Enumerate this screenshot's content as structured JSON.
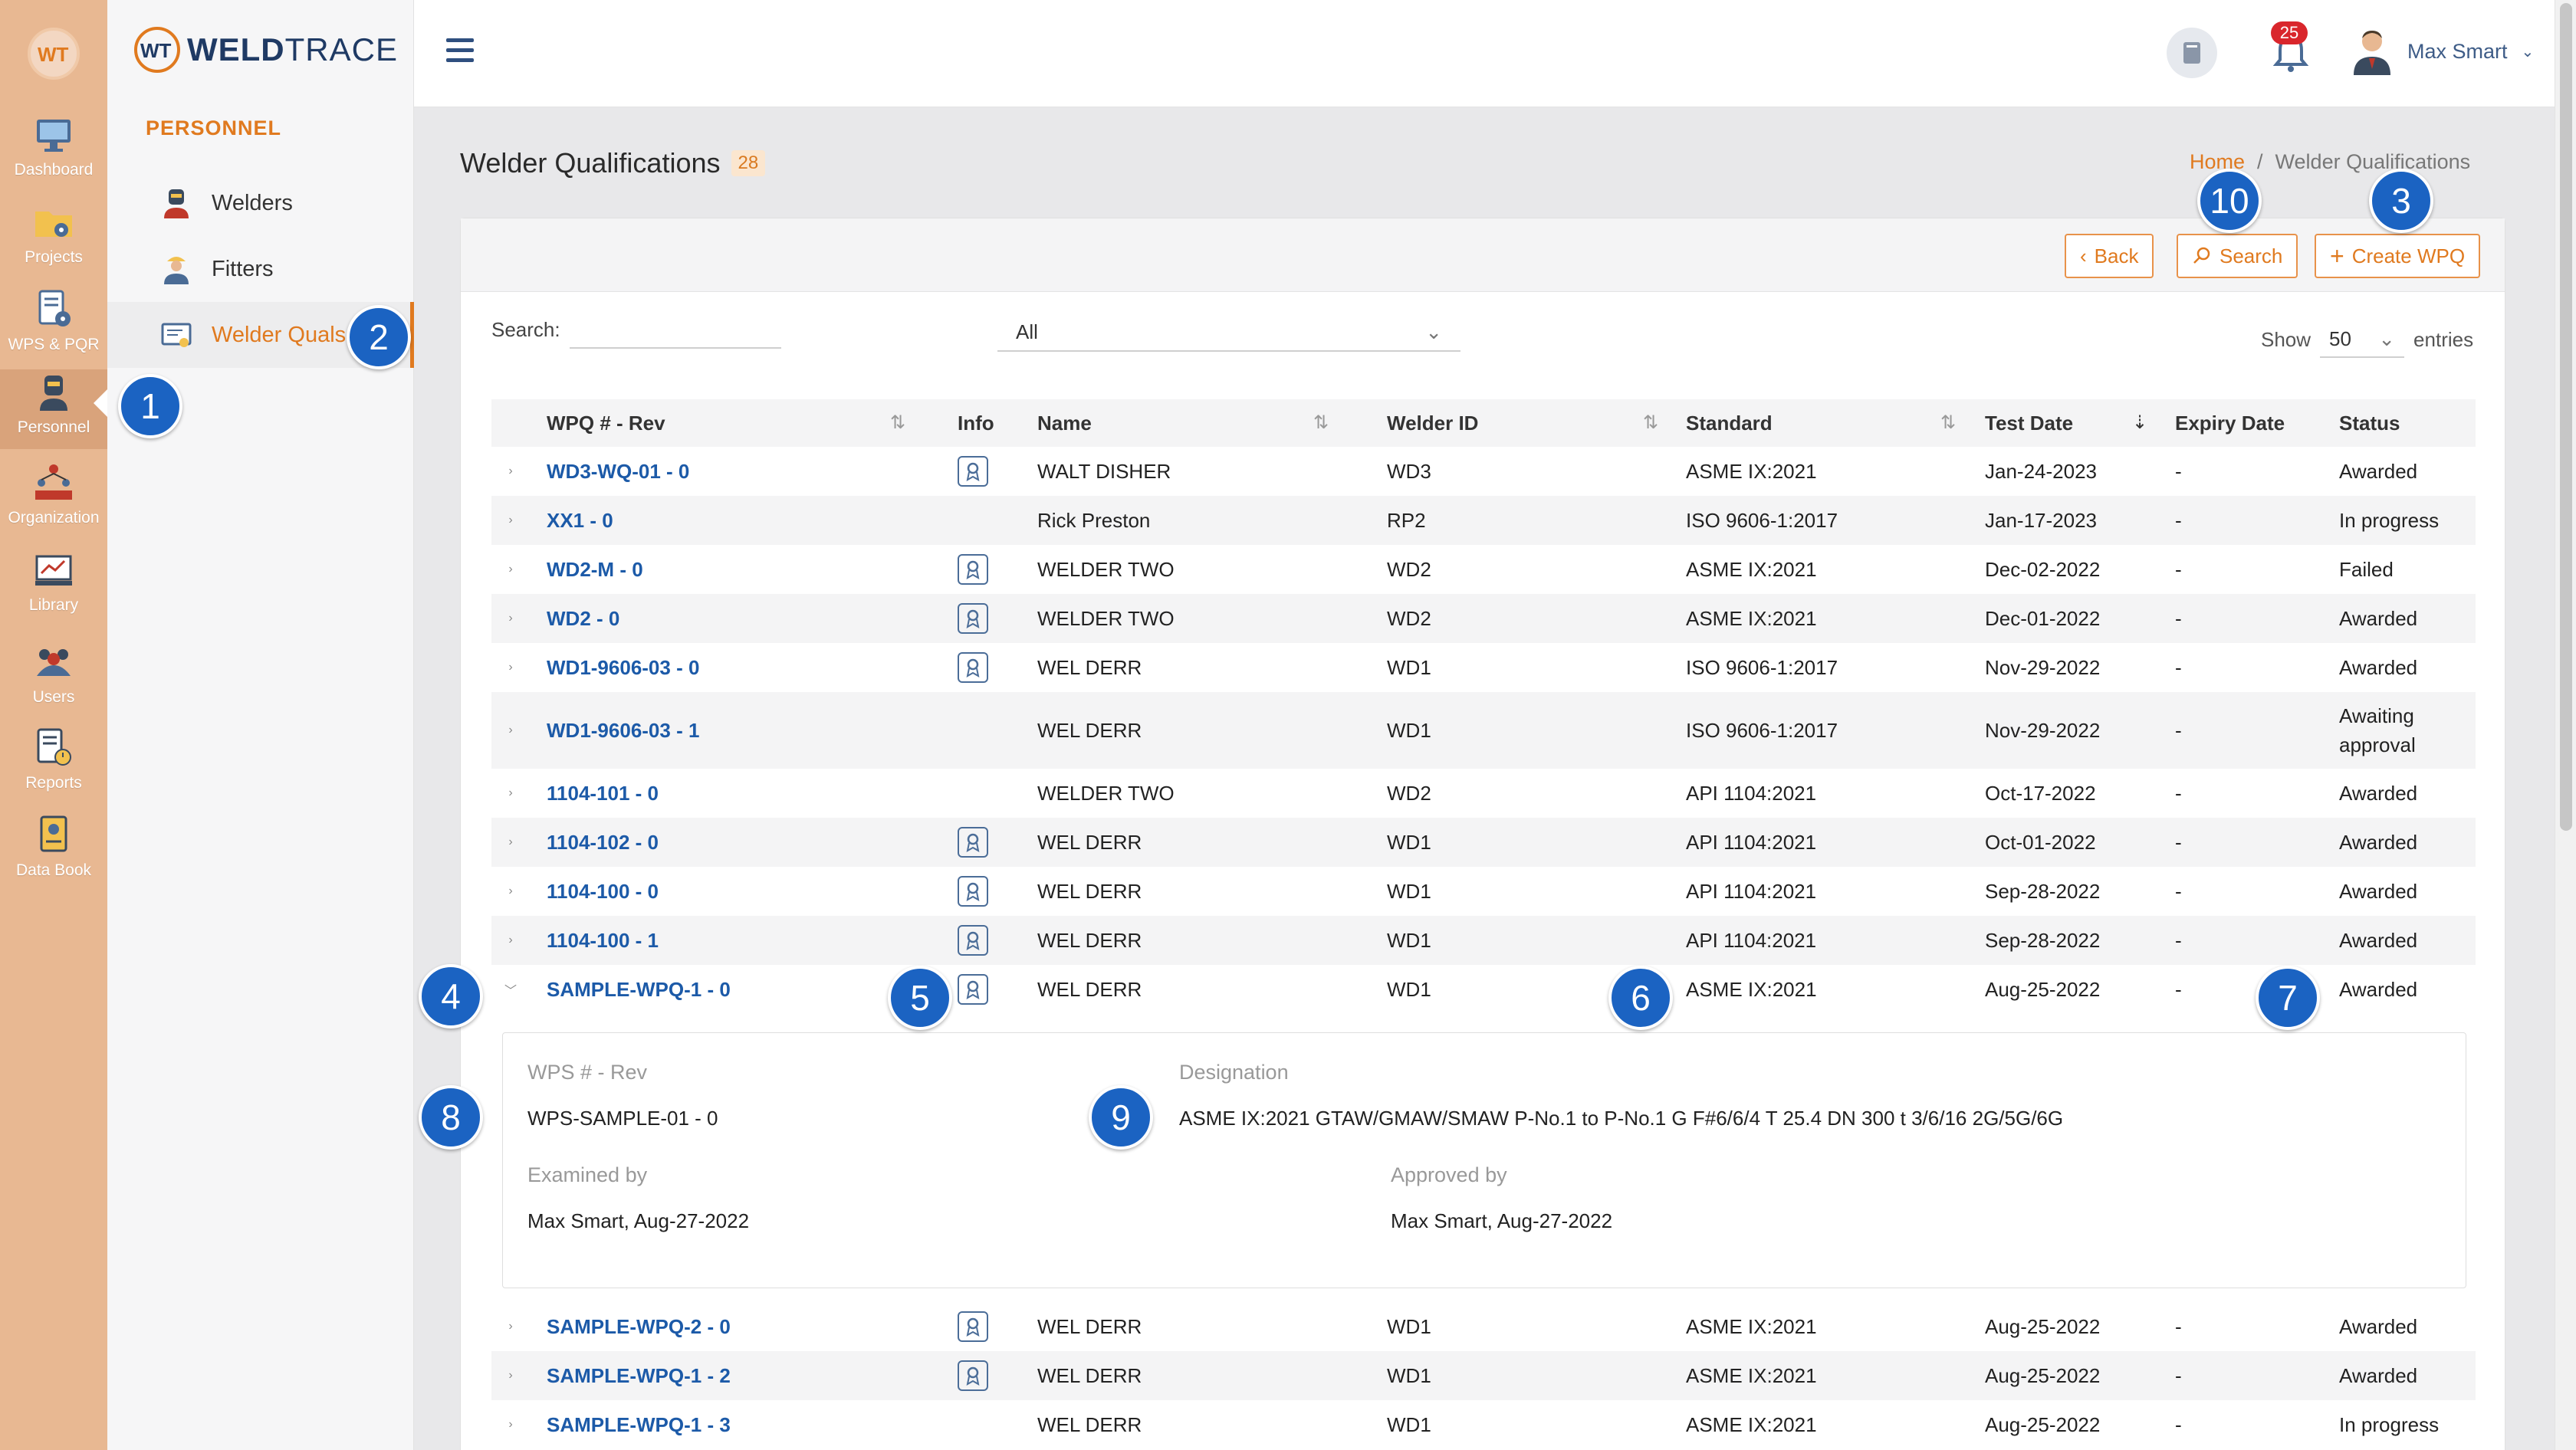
{
  "rail": {
    "items": [
      {
        "label": "Dashboard"
      },
      {
        "label": "Projects"
      },
      {
        "label": "WPS & PQR"
      },
      {
        "label": "Personnel"
      },
      {
        "label": "Organization"
      },
      {
        "label": "Library"
      },
      {
        "label": "Users"
      },
      {
        "label": "Reports"
      },
      {
        "label": "Data Book"
      }
    ]
  },
  "brand": {
    "bold": "WELD",
    "thin": "TRACE",
    "logo_text": "WT"
  },
  "subnav": {
    "section": "PERSONNEL",
    "items": [
      {
        "label": "Welders"
      },
      {
        "label": "Fitters"
      },
      {
        "label": "Welder Quals"
      }
    ]
  },
  "topbar": {
    "notifications": "25",
    "user_name": "Max Smart"
  },
  "page": {
    "title": "Welder Qualifications",
    "count": "28",
    "breadcrumb_home": "Home",
    "breadcrumb_sep": "/",
    "breadcrumb_current": "Welder Qualifications"
  },
  "actions": {
    "back": "Back",
    "search": "Search",
    "create": "Create WPQ"
  },
  "filters": {
    "search_label": "Search:",
    "search_value": "",
    "status_filter": "All",
    "show_label": "Show",
    "show_value": "50",
    "entries_label": "entries"
  },
  "table": {
    "columns": [
      "WPQ # - Rev",
      "Info",
      "Name",
      "Welder ID",
      "Standard",
      "Test Date",
      "Expiry Date",
      "Status"
    ],
    "rows": [
      {
        "wpq": "WD3-WQ-01 - 0",
        "name": "WALT DISHER",
        "welder_id": "WD3",
        "standard": "ASME IX:2021",
        "test_date": "Jan-24-2023",
        "expiry": "-",
        "status": "Awarded"
      },
      {
        "wpq": "XX1 - 0",
        "name": "Rick Preston",
        "welder_id": "RP2",
        "standard": "ISO 9606-1:2017",
        "test_date": "Jan-17-2023",
        "expiry": "-",
        "status": "In progress"
      },
      {
        "wpq": "WD2-M - 0",
        "name": "WELDER TWO",
        "welder_id": "WD2",
        "standard": "ASME IX:2021",
        "test_date": "Dec-02-2022",
        "expiry": "-",
        "status": "Failed"
      },
      {
        "wpq": "WD2 - 0",
        "name": "WELDER TWO",
        "welder_id": "WD2",
        "standard": "ASME IX:2021",
        "test_date": "Dec-01-2022",
        "expiry": "-",
        "status": "Awarded"
      },
      {
        "wpq": "WD1-9606-03 - 0",
        "name": "WEL DERR",
        "welder_id": "WD1",
        "standard": "ISO 9606-1:2017",
        "test_date": "Nov-29-2022",
        "expiry": "-",
        "status": "Awarded"
      },
      {
        "wpq": "WD1-9606-03 - 1",
        "name": "WEL DERR",
        "welder_id": "WD1",
        "standard": "ISO 9606-1:2017",
        "test_date": "Nov-29-2022",
        "expiry": "-",
        "status": "Awaiting",
        "status2": "approval"
      },
      {
        "wpq": "1104-101 - 0",
        "name": "WELDER TWO",
        "welder_id": "WD2",
        "standard": "API 1104:2021",
        "test_date": "Oct-17-2022",
        "expiry": "-",
        "status": "Awarded"
      },
      {
        "wpq": "1104-102 - 0",
        "name": "WEL DERR",
        "welder_id": "WD1",
        "standard": "API 1104:2021",
        "test_date": "Oct-01-2022",
        "expiry": "-",
        "status": "Awarded"
      },
      {
        "wpq": "1104-100 - 0",
        "name": "WEL DERR",
        "welder_id": "WD1",
        "standard": "API 1104:2021",
        "test_date": "Sep-28-2022",
        "expiry": "-",
        "status": "Awarded"
      },
      {
        "wpq": "1104-100 - 1",
        "name": "WEL DERR",
        "welder_id": "WD1",
        "standard": "API 1104:2021",
        "test_date": "Sep-28-2022",
        "expiry": "-",
        "status": "Awarded"
      },
      {
        "wpq": "SAMPLE-WPQ-1 - 0",
        "name": "WEL DERR",
        "welder_id": "WD1",
        "standard": "ASME IX:2021",
        "test_date": "Aug-25-2022",
        "expiry": "-",
        "status": "Awarded"
      },
      {
        "wpq": "SAMPLE-WPQ-2 - 0",
        "name": "WEL DERR",
        "welder_id": "WD1",
        "standard": "ASME IX:2021",
        "test_date": "Aug-25-2022",
        "expiry": "-",
        "status": "Awarded"
      },
      {
        "wpq": "SAMPLE-WPQ-1 - 2",
        "name": "WEL DERR",
        "welder_id": "WD1",
        "standard": "ASME IX:2021",
        "test_date": "Aug-25-2022",
        "expiry": "-",
        "status": "Awarded"
      },
      {
        "wpq": "SAMPLE-WPQ-1 - 3",
        "name": "WEL DERR",
        "welder_id": "WD1",
        "standard": "ASME IX:2021",
        "test_date": "Aug-25-2022",
        "expiry": "-",
        "status": "In progress"
      }
    ]
  },
  "detail": {
    "wps_label": "WPS # - Rev",
    "wps_value": "WPS-SAMPLE-01 - 0",
    "designation_label": "Designation",
    "designation_value": "ASME IX:2021 GTAW/GMAW/SMAW P-No.1 to P-No.1 G F#6/6/4 T 25.4 DN 300 t 3/6/16 2G/5G/6G",
    "examined_label": "Examined by",
    "examined_value": "Max Smart, Aug-27-2022",
    "approved_label": "Approved by",
    "approved_value": "Max Smart, Aug-27-2022"
  },
  "markers": [
    "1",
    "2",
    "3",
    "4",
    "5",
    "6",
    "7",
    "8",
    "9",
    "10"
  ],
  "colors": {
    "accent": "#e07a1f",
    "rail": "#e8b892",
    "link": "#1c5aa8",
    "marker": "#1b63c2",
    "badge": "#d9262c"
  }
}
